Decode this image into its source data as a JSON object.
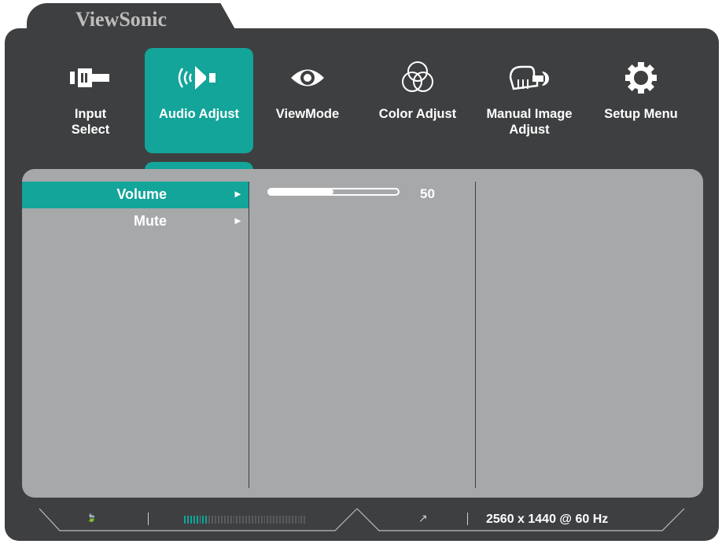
{
  "brand": "ViewSonic",
  "colors": {
    "accent": "#13a49a",
    "frame": "#3e3f41",
    "panel": "#a7a8aa"
  },
  "nav": {
    "items": [
      {
        "label": "Input\nSelect",
        "icon": "input-select-icon"
      },
      {
        "label": "Audio Adjust",
        "icon": "speaker-icon",
        "active": true
      },
      {
        "label": "ViewMode",
        "icon": "eye-icon"
      },
      {
        "label": "Color Adjust",
        "icon": "color-circles-icon"
      },
      {
        "label": "Manual Image\nAdjust",
        "icon": "hand-wrench-icon"
      },
      {
        "label": "Setup Menu",
        "icon": "gear-icon"
      }
    ]
  },
  "menu": {
    "items": [
      {
        "label": "Volume",
        "arrow": "►",
        "selected": true
      },
      {
        "label": "Mute",
        "arrow": "►"
      }
    ]
  },
  "volume": {
    "value": "50",
    "fraction": 0.5
  },
  "status": {
    "eco_icon": "eco-icon",
    "meter_fraction": 0.2,
    "external_icon": "external-link-icon",
    "resolution": "2560 x 1440 @ 60 Hz"
  }
}
